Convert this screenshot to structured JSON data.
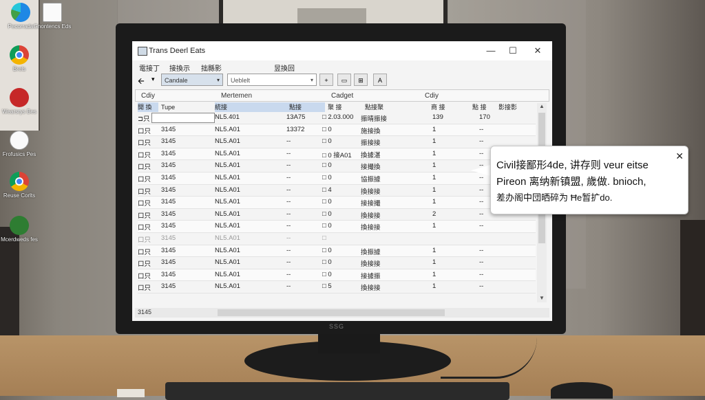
{
  "desktop": {
    "icons": [
      {
        "name": "edge",
        "label": "Pecorrada"
      },
      {
        "name": "shortcut",
        "label": "Gnontencs Eds"
      },
      {
        "name": "chrome",
        "label": "Brels"
      },
      {
        "name": "excel",
        "label": "Wearsrys Bes"
      },
      {
        "name": "doc",
        "label": "Frofusics Pes"
      },
      {
        "name": "chrome2",
        "label": "Reuse Corlts"
      },
      {
        "name": "sheets",
        "label": "Mcerdweds fes"
      }
    ],
    "monitor_brand": "SSG"
  },
  "window": {
    "title": "Trans Deerl Eats",
    "minimize": "—",
    "maximize": "☐",
    "close": "✕"
  },
  "menu": [
    "電接丁",
    "接換示",
    "拙縣影",
    "昱換回"
  ],
  "toolbar": {
    "back": "🡨",
    "drop": "▾",
    "select_value": "Candale",
    "search_value": "Ueblelt",
    "add": "+",
    "btn1": "▭",
    "btn2": "⊞",
    "btn3": "A"
  },
  "sections": [
    "Cdiy",
    "Mertemen",
    "Cadget",
    "Cdiy"
  ],
  "columns": [
    "開 換",
    "Tupe",
    "統接",
    "點接",
    "聚 接",
    "點接聚",
    "商 接",
    "點 接",
    "影接影"
  ],
  "rows": [
    {
      "c1": "⊐只",
      "c2": "",
      "c3": "NL5.401",
      "c4": "13A75",
      "c5": "□ 2.03.000",
      "c6": "振晴振接",
      "c7": "139",
      "c8": "170"
    },
    {
      "c1": "口只",
      "c2": "3145",
      "c3": "NL5.A01",
      "c4": "13372",
      "c5": "□ 0",
      "c6": "施接換",
      "c7": "1",
      "c8": "--"
    },
    {
      "c1": "口只",
      "c2": "3145",
      "c3": "NL5.A01",
      "c4": "--",
      "c5": "□ 0",
      "c6": "振接接",
      "c7": "1",
      "c8": "--"
    },
    {
      "c1": "口只",
      "c2": "3145",
      "c3": "NL5.A01",
      "c4": "--",
      "c5": "□ 0  接A01",
      "c6": "換據湛",
      "c7": "1",
      "c8": "--"
    },
    {
      "c1": "口只",
      "c2": "3145",
      "c3": "NL5.A01",
      "c4": "--",
      "c5": "□ 0",
      "c6": "接撮換",
      "c7": "1",
      "c8": "--"
    },
    {
      "c1": "口只",
      "c2": "3145",
      "c3": "NL5.A01",
      "c4": "--",
      "c5": "□ 0",
      "c6": "協振據",
      "c7": "1",
      "c8": "--"
    },
    {
      "c1": "口只",
      "c2": "3145",
      "c3": "NL5.A01",
      "c4": "--",
      "c5": "□ 4",
      "c6": "換接接",
      "c7": "1",
      "c8": "--"
    },
    {
      "c1": "口只",
      "c2": "3145",
      "c3": "NL5.A01",
      "c4": "--",
      "c5": "□ 0",
      "c6": "接接撮",
      "c7": "1",
      "c8": "--"
    },
    {
      "c1": "口只",
      "c2": "3145",
      "c3": "NL5.A01",
      "c4": "--",
      "c5": "□ 0",
      "c6": "換接接",
      "c7": "2",
      "c8": "--"
    },
    {
      "c1": "口只",
      "c2": "3145",
      "c3": "NL5.A01",
      "c4": "--",
      "c5": "□ 0",
      "c6": "換接接",
      "c7": "1",
      "c8": "--"
    },
    {
      "c1": "口只",
      "c2": "3145",
      "c3": "NL5.A01",
      "c4": "--",
      "c5": "□",
      "c6": "",
      "c7": "",
      "c8": ""
    },
    {
      "c1": "口只",
      "c2": "3145",
      "c3": "NL5.A01",
      "c4": "--",
      "c5": "□ 0",
      "c6": "換振據",
      "c7": "1",
      "c8": "--"
    },
    {
      "c1": "口只",
      "c2": "3145",
      "c3": "NL5.A01",
      "c4": "--",
      "c5": "□ 0",
      "c6": "換接接",
      "c7": "1",
      "c8": "--"
    },
    {
      "c1": "口只",
      "c2": "3145",
      "c3": "NL5.A01",
      "c4": "--",
      "c5": "□ 0",
      "c6": "接據振",
      "c7": "1",
      "c8": "--"
    },
    {
      "c1": "口只",
      "c2": "3145",
      "c3": "NL5.A01",
      "c4": "--",
      "c5": "□ 5",
      "c6": "換接接",
      "c7": "1",
      "c8": "--"
    }
  ],
  "status": {
    "text": "3145"
  },
  "scroll": {
    "up": "▲",
    "down": "▼"
  },
  "tooltip": {
    "line1": "Civil接鄙形4de, 讲存则 veur eitse",
    "line2": "Pireon 离纳新镇盟, 歲做. bnioch,",
    "line3": "差办阁中団晒碎为 Ħe暂扩do.",
    "close": "✕"
  }
}
